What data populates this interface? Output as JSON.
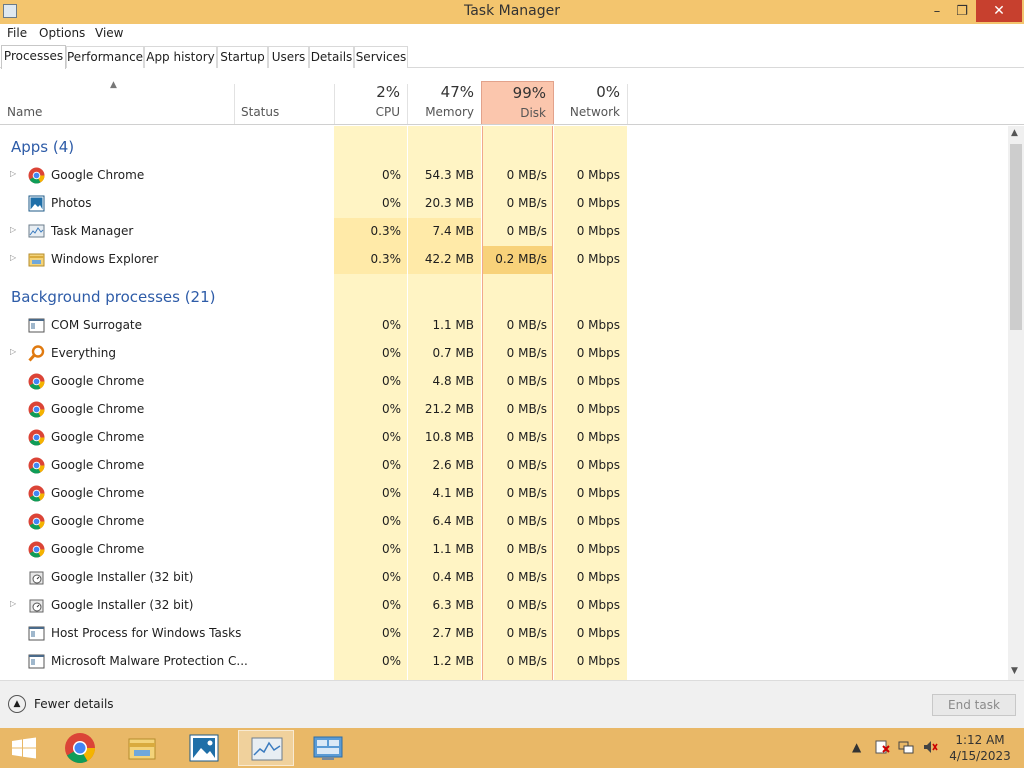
{
  "window": {
    "title": "Task Manager",
    "minimize": "–",
    "maximize": "❐",
    "close": "✕"
  },
  "menu": [
    "File",
    "Options",
    "View"
  ],
  "tabs": [
    "Processes",
    "Performance",
    "App history",
    "Startup",
    "Users",
    "Details",
    "Services"
  ],
  "columns": {
    "name": "Name",
    "status": "Status",
    "cpu": {
      "pct": "2%",
      "label": "CPU"
    },
    "memory": {
      "pct": "47%",
      "label": "Memory"
    },
    "disk": {
      "pct": "99%",
      "label": "Disk"
    },
    "network": {
      "pct": "0%",
      "label": "Network"
    }
  },
  "groups": {
    "apps": "Apps (4)",
    "background": "Background processes (21)"
  },
  "apps": [
    {
      "name": "Google Chrome",
      "icon": "chrome-icon",
      "expandable": true,
      "cpu": "0%",
      "mem": "54.3 MB",
      "disk": "0 MB/s",
      "net": "0 Mbps"
    },
    {
      "name": "Photos",
      "icon": "photos-icon",
      "expandable": false,
      "cpu": "0%",
      "mem": "20.3 MB",
      "disk": "0 MB/s",
      "net": "0 Mbps"
    },
    {
      "name": "Task Manager",
      "icon": "task-manager-icon",
      "expandable": true,
      "cpu": "0.3%",
      "mem": "7.4 MB",
      "disk": "0 MB/s",
      "net": "0 Mbps"
    },
    {
      "name": "Windows Explorer",
      "icon": "explorer-icon",
      "expandable": true,
      "cpu": "0.3%",
      "mem": "42.2 MB",
      "disk": "0.2 MB/s",
      "net": "0 Mbps"
    }
  ],
  "background": [
    {
      "name": "COM Surrogate",
      "icon": "process-icon",
      "expandable": false,
      "cpu": "0%",
      "mem": "1.1 MB",
      "disk": "0 MB/s",
      "net": "0 Mbps"
    },
    {
      "name": "Everything",
      "icon": "everything-icon",
      "expandable": true,
      "cpu": "0%",
      "mem": "0.7 MB",
      "disk": "0 MB/s",
      "net": "0 Mbps"
    },
    {
      "name": "Google Chrome",
      "icon": "chrome-icon",
      "expandable": false,
      "cpu": "0%",
      "mem": "4.8 MB",
      "disk": "0 MB/s",
      "net": "0 Mbps"
    },
    {
      "name": "Google Chrome",
      "icon": "chrome-icon",
      "expandable": false,
      "cpu": "0%",
      "mem": "21.2 MB",
      "disk": "0 MB/s",
      "net": "0 Mbps"
    },
    {
      "name": "Google Chrome",
      "icon": "chrome-icon",
      "expandable": false,
      "cpu": "0%",
      "mem": "10.8 MB",
      "disk": "0 MB/s",
      "net": "0 Mbps"
    },
    {
      "name": "Google Chrome",
      "icon": "chrome-icon",
      "expandable": false,
      "cpu": "0%",
      "mem": "2.6 MB",
      "disk": "0 MB/s",
      "net": "0 Mbps"
    },
    {
      "name": "Google Chrome",
      "icon": "chrome-icon",
      "expandable": false,
      "cpu": "0%",
      "mem": "4.1 MB",
      "disk": "0 MB/s",
      "net": "0 Mbps"
    },
    {
      "name": "Google Chrome",
      "icon": "chrome-icon",
      "expandable": false,
      "cpu": "0%",
      "mem": "6.4 MB",
      "disk": "0 MB/s",
      "net": "0 Mbps"
    },
    {
      "name": "Google Chrome",
      "icon": "chrome-icon",
      "expandable": false,
      "cpu": "0%",
      "mem": "1.1 MB",
      "disk": "0 MB/s",
      "net": "0 Mbps"
    },
    {
      "name": "Google Installer (32 bit)",
      "icon": "installer-icon",
      "expandable": false,
      "cpu": "0%",
      "mem": "0.4 MB",
      "disk": "0 MB/s",
      "net": "0 Mbps"
    },
    {
      "name": "Google Installer (32 bit)",
      "icon": "installer-icon",
      "expandable": true,
      "cpu": "0%",
      "mem": "6.3 MB",
      "disk": "0 MB/s",
      "net": "0 Mbps"
    },
    {
      "name": "Host Process for Windows Tasks",
      "icon": "process-icon",
      "expandable": false,
      "cpu": "0%",
      "mem": "2.7 MB",
      "disk": "0 MB/s",
      "net": "0 Mbps"
    },
    {
      "name": "Microsoft Malware Protection C...",
      "icon": "process-icon",
      "expandable": false,
      "cpu": "0%",
      "mem": "1.2 MB",
      "disk": "0 MB/s",
      "net": "0 Mbps"
    }
  ],
  "footer": {
    "fewer_details": "Fewer details",
    "end_task": "End task"
  },
  "taskbar": {
    "items": [
      "start-icon",
      "chrome-icon",
      "file-explorer-icon",
      "photos-icon",
      "task-manager-icon",
      "control-panel-icon"
    ],
    "time": "1:12 AM",
    "date": "4/15/2023"
  },
  "colors": {
    "titlebar": "#f3c56e",
    "taskbar": "#e9b867",
    "heat": "#fff4c4",
    "disk_hot": "#fbc6ad",
    "group_text": "#2e5ca8"
  }
}
